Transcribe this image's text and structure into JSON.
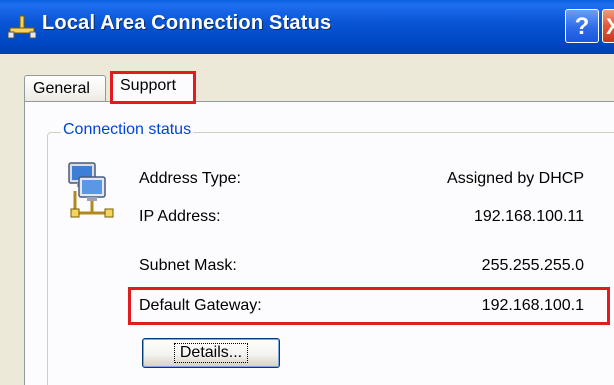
{
  "window": {
    "title": "Local Area Connection Status",
    "help_button": "?",
    "close_button": "X"
  },
  "tabs": [
    {
      "label": "General",
      "selected": false
    },
    {
      "label": "Support",
      "selected": true,
      "highlighted": true
    }
  ],
  "connection_status": {
    "group_title": "Connection status",
    "icon": "network-connection-icon",
    "rows": [
      {
        "label": "Address Type:",
        "value": "Assigned by DHCP"
      },
      {
        "label": "IP Address:",
        "value": "192.168.100.11"
      },
      {
        "label": "Subnet Mask:",
        "value": "255.255.255.0"
      },
      {
        "label": "Default Gateway:",
        "value": "192.168.100.1",
        "highlighted": true
      }
    ],
    "details_button": "Details..."
  },
  "colors": {
    "titlebar": "#0a56d6",
    "highlight": "#e21b23",
    "group_title": "#0046d5",
    "dialog_bg": "#ece9d8"
  }
}
